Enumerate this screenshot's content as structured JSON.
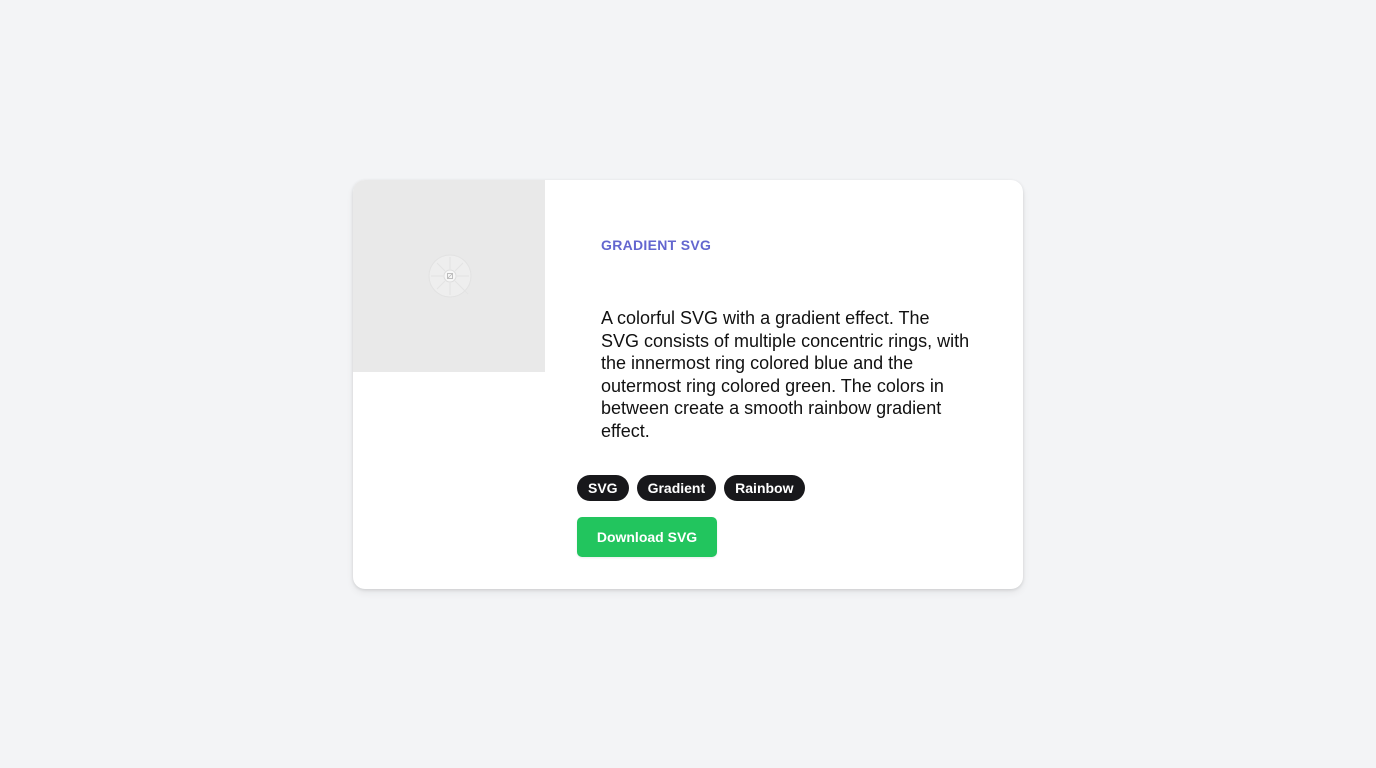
{
  "card": {
    "category": "GRADIENT SVG",
    "description": "A colorful SVG with a gradient effect. The SVG consists of multiple concentric rings, with the innermost ring colored blue and the outermost ring colored green. The colors in between create a smooth rainbow gradient effect.",
    "tags": [
      "SVG",
      "Gradient",
      "Rainbow"
    ],
    "download_label": "Download SVG",
    "preview_icon": "broken-image-icon"
  },
  "colors": {
    "background": "#f3f4f6",
    "card": "#ffffff",
    "accent": "#6366cf",
    "tag": "#18181b",
    "button": "#22c55e"
  }
}
